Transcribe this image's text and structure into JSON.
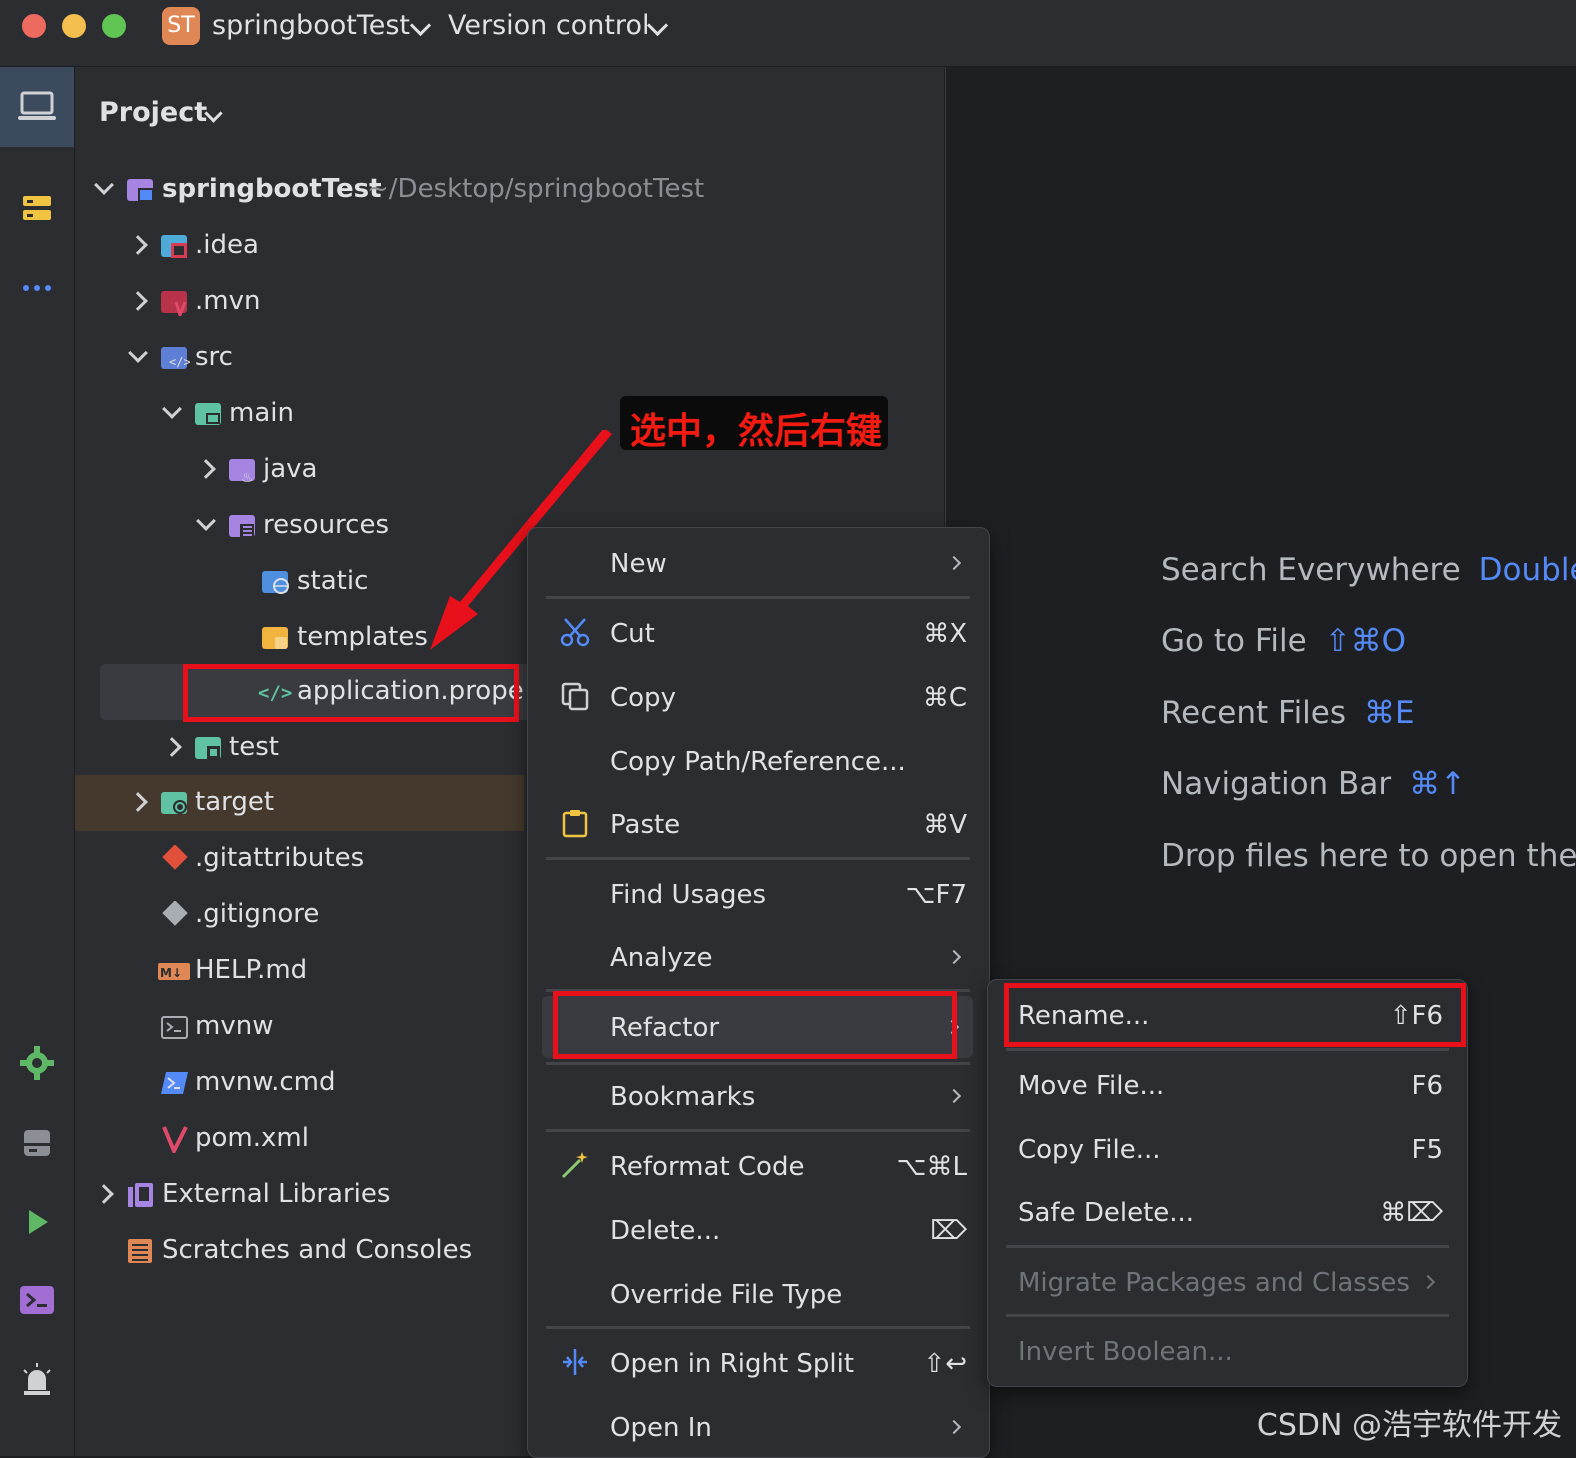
{
  "titlebar": {
    "project_badge": "ST",
    "project_name": "springbootTest",
    "vcs_label": "Version control"
  },
  "sidebar": {
    "icons": [
      "project-icon",
      "structure-icon",
      "more-icon",
      "settings-icon",
      "services-icon",
      "run-icon",
      "terminal-icon",
      "problems-icon"
    ]
  },
  "panel": {
    "title": "Project"
  },
  "tree": {
    "root": {
      "name": "springbootTest",
      "path": "~/Desktop/springbootTest"
    },
    "items": [
      ".idea",
      ".mvn",
      "src",
      "main",
      "java",
      "resources",
      "static",
      "templates",
      "application.properties",
      "test",
      "target",
      ".gitattributes",
      ".gitignore",
      "HELP.md",
      "mvnw",
      "mvnw.cmd",
      "pom.xml",
      "External Libraries",
      "Scratches and Consoles"
    ]
  },
  "callout": {
    "text": "选中，然后右键"
  },
  "context_menu": {
    "items": [
      {
        "label": "New",
        "shortcut": ""
      },
      {
        "label": "Cut",
        "shortcut": "⌘X"
      },
      {
        "label": "Copy",
        "shortcut": "⌘C"
      },
      {
        "label": "Copy Path/Reference...",
        "shortcut": ""
      },
      {
        "label": "Paste",
        "shortcut": "⌘V"
      },
      {
        "label": "Find Usages",
        "shortcut": "⌥F7"
      },
      {
        "label": "Analyze",
        "shortcut": ""
      },
      {
        "label": "Refactor",
        "shortcut": ""
      },
      {
        "label": "Bookmarks",
        "shortcut": ""
      },
      {
        "label": "Reformat Code",
        "shortcut": "⌥⌘L"
      },
      {
        "label": "Delete...",
        "shortcut": "⌦"
      },
      {
        "label": "Override File Type",
        "shortcut": ""
      },
      {
        "label": "Open in Right Split",
        "shortcut": "⇧↩"
      },
      {
        "label": "Open In",
        "shortcut": ""
      }
    ]
  },
  "refactor_submenu": {
    "items": [
      {
        "label": "Rename...",
        "shortcut": "⇧F6"
      },
      {
        "label": "Move File...",
        "shortcut": "F6"
      },
      {
        "label": "Copy File...",
        "shortcut": "F5"
      },
      {
        "label": "Safe Delete...",
        "shortcut": "⌘⌦"
      },
      {
        "label": "Migrate Packages and Classes",
        "shortcut": ""
      },
      {
        "label": "Invert Boolean...",
        "shortcut": ""
      }
    ]
  },
  "editor_hints": [
    {
      "label": "Search Everywhere",
      "key": "Double"
    },
    {
      "label": "Go to File",
      "key": "⇧⌘O"
    },
    {
      "label": "Recent Files",
      "key": "⌘E"
    },
    {
      "label": "Navigation Bar",
      "key": "⌘↑"
    },
    {
      "label": "Drop files here to open them",
      "key": ""
    }
  ],
  "watermark": "CSDN @浩宇软件开发",
  "colors": {
    "accent": "#548af7",
    "highlight_red": "#e8101a",
    "background": "#1e1f22",
    "panel": "#2b2d30"
  }
}
